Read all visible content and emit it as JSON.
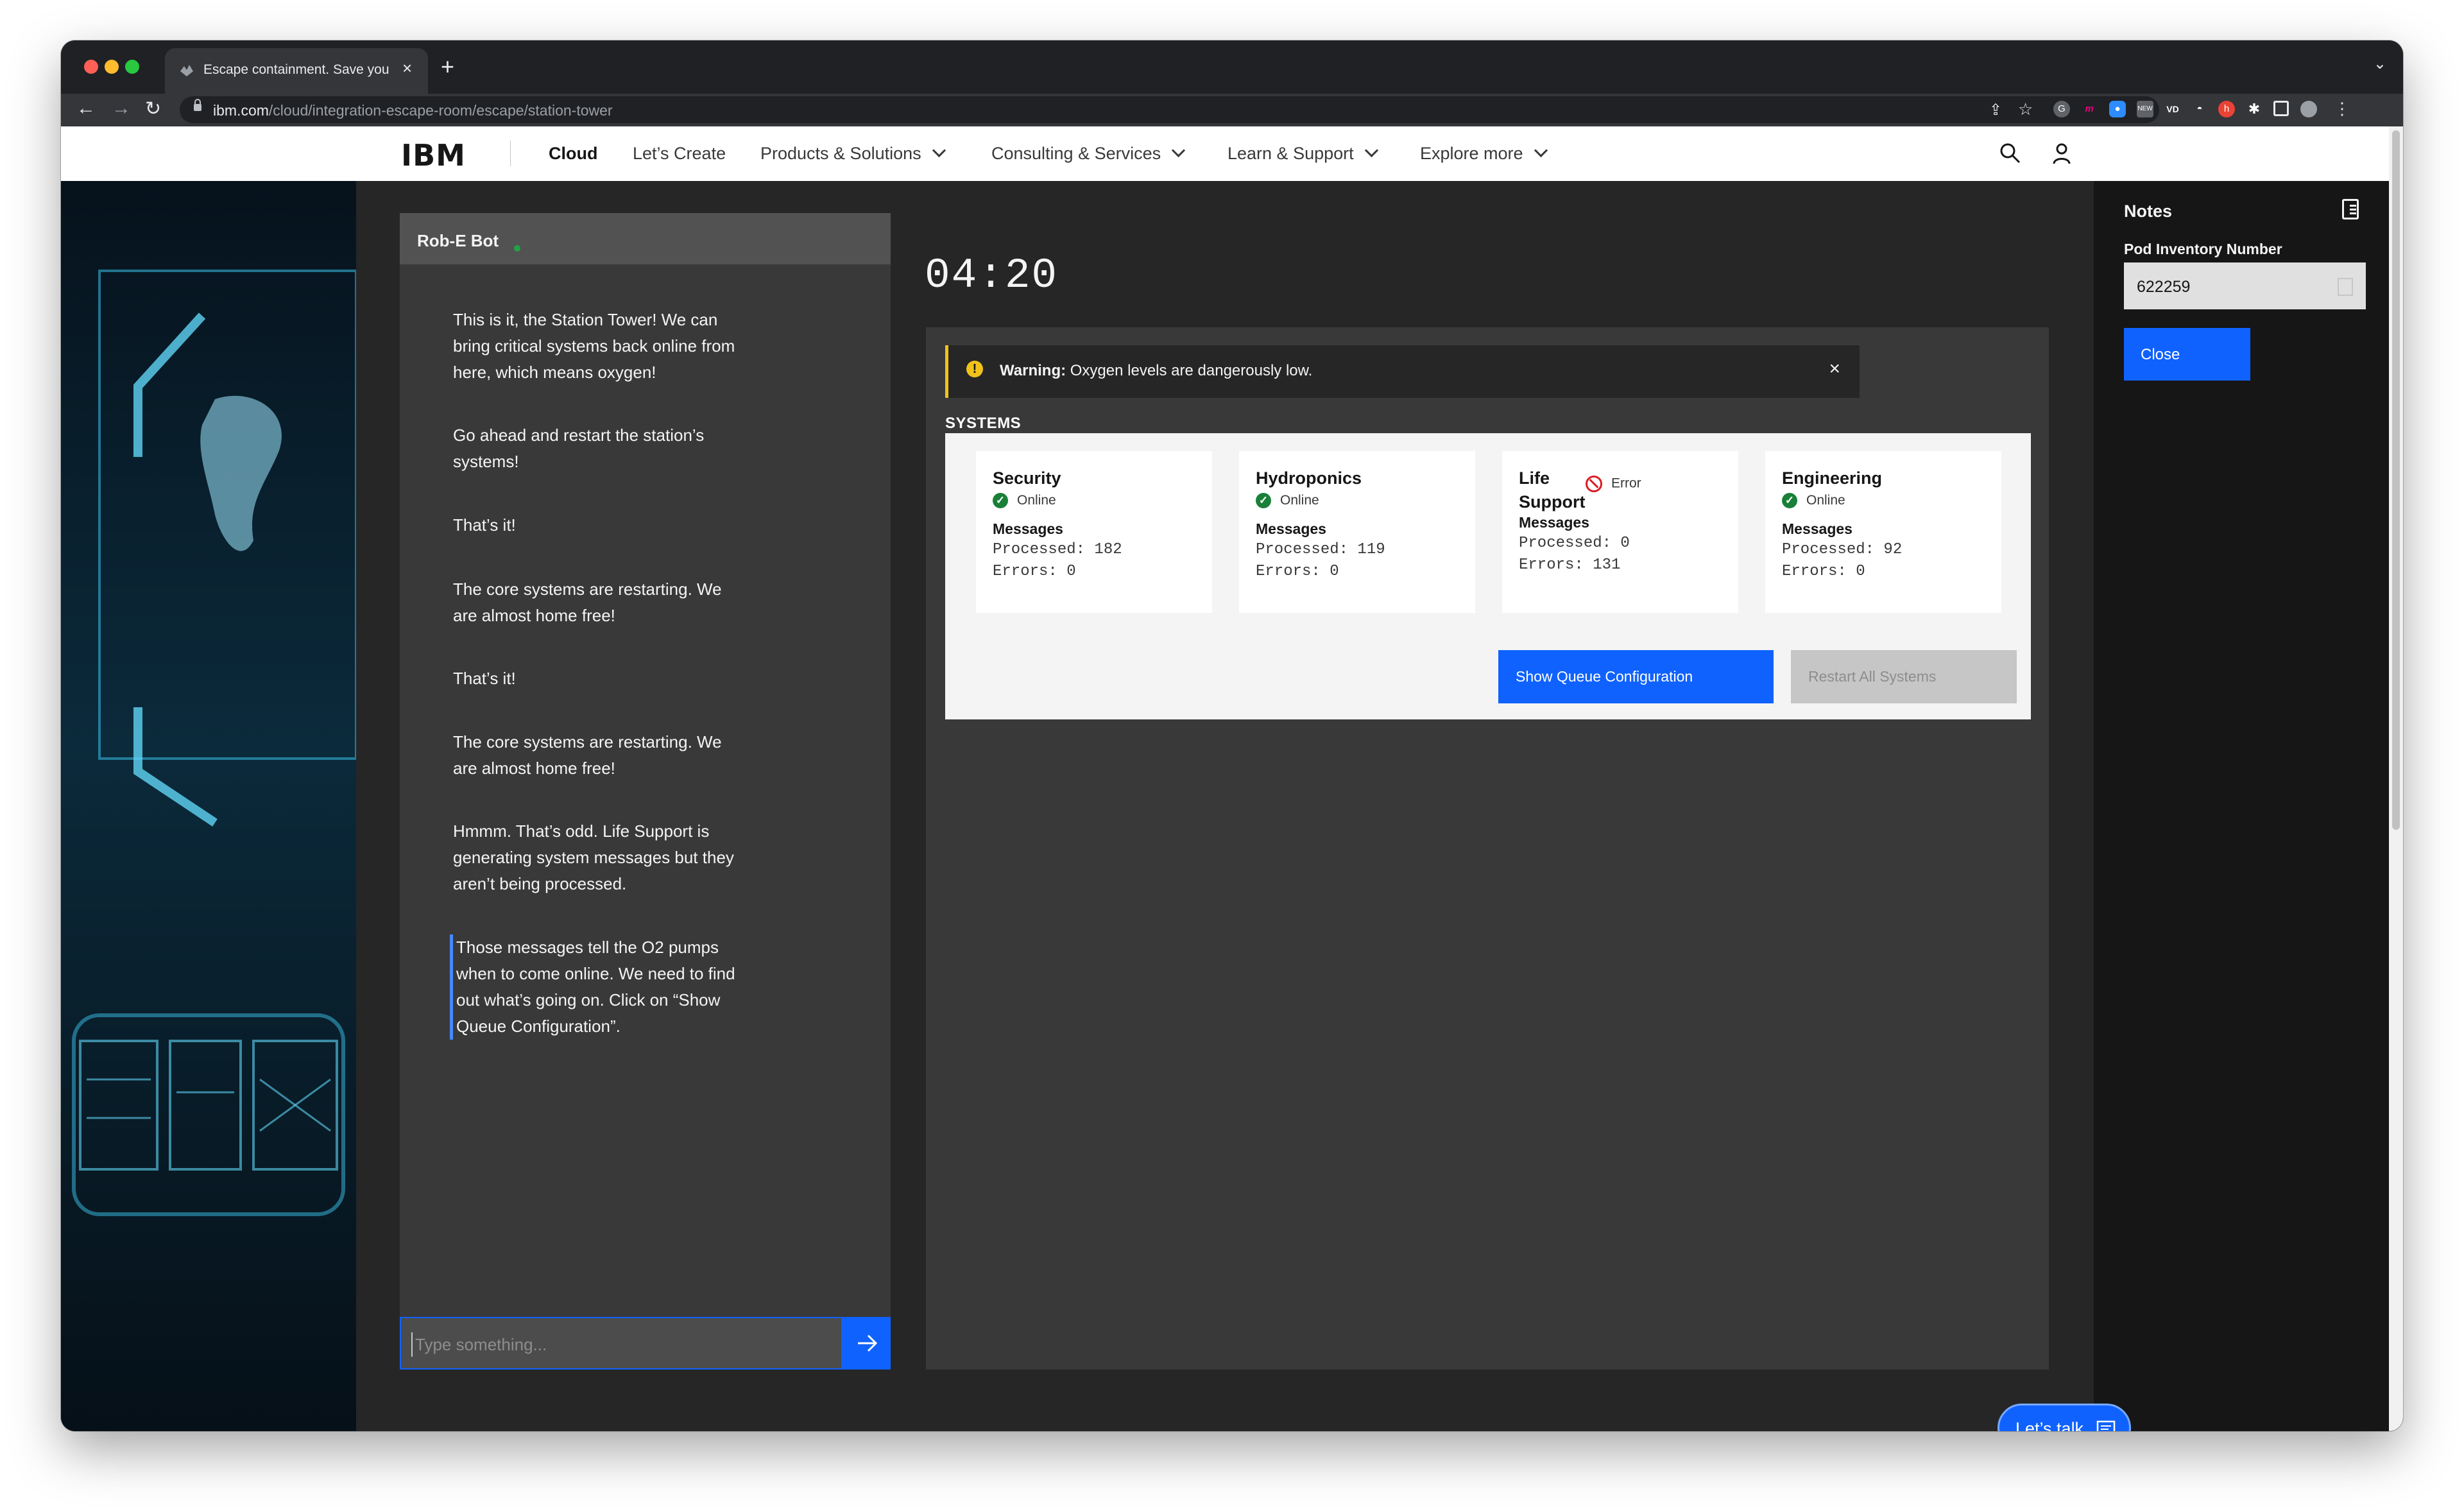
{
  "browser": {
    "tab_title": "Escape containment. Save you",
    "url_host": "ibm.com",
    "url_path": "/cloud/integration-escape-room/escape/station-tower"
  },
  "masthead": {
    "logo": "IBM",
    "nav": [
      {
        "label": "Cloud"
      },
      {
        "label": "Let’s Create"
      },
      {
        "label": "Products & Solutions"
      },
      {
        "label": "Consulting & Services"
      },
      {
        "label": "Learn & Support"
      },
      {
        "label": "Explore more"
      }
    ]
  },
  "chat": {
    "bot_name": "Rob-E Bot",
    "messages": [
      "This is it, the Station Tower! We can bring critical systems back online from here, which means oxygen!",
      "Go ahead and restart the station’s systems!",
      "That’s it!",
      "The core systems are restarting. We are almost home free!",
      "That’s it!",
      "The core systems are restarting. We are almost home free!",
      "Hmmm. That’s odd. Life Support is generating system messages but they aren’t being processed.",
      "Those messages tell the O2 pumps when to come online. We need to find out what’s going on. Click on “Show Queue Configuration”."
    ],
    "input_placeholder": "Type something..."
  },
  "timer": "04:20",
  "warning": {
    "label": "Warning:",
    "text": "Oxygen levels are dangerously low."
  },
  "systems": {
    "heading": "SYSTEMS",
    "cards": [
      {
        "name": "Security",
        "status": "Online",
        "messages_label": "Messages",
        "processed": "Processed: 182",
        "errors": "Errors: 0"
      },
      {
        "name": "Hydroponics",
        "status": "Online",
        "messages_label": "Messages",
        "processed": "Processed: 119",
        "errors": "Errors: 0"
      },
      {
        "name": "Life Support",
        "status": "Error",
        "messages_label": "Messages",
        "processed": "Processed: 0",
        "errors": "Errors: 131"
      },
      {
        "name": "Engineering",
        "status": "Online",
        "messages_label": "Messages",
        "processed": "Processed: 92",
        "errors": "Errors: 0"
      }
    ],
    "show_queue_label": "Show Queue Configuration",
    "restart_label": "Restart All Systems"
  },
  "notes": {
    "title": "Notes",
    "field_label": "Pod Inventory Number",
    "field_value": "622259",
    "close_label": "Close"
  },
  "lets_talk": "Let’s talk",
  "colors": {
    "accent": "#0f62fe",
    "warning": "#f1c21b",
    "success": "#198038",
    "error": "#da1e28"
  }
}
